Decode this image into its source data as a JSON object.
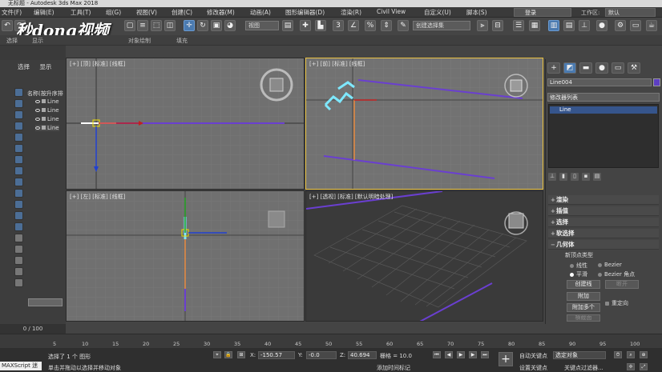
{
  "window": {
    "title": "无标题 - Autodesk 3ds Max 2018"
  },
  "menu": [
    "文件(F)",
    "编辑(E)",
    "工具(T)",
    "组(G)",
    "视图(V)",
    "创建(C)",
    "修改器(M)",
    "动画(A)",
    "图形编辑器(D)",
    "渲染(R)",
    "Civil View",
    "自定义(U)",
    "脚本(S)"
  ],
  "signin": "登录",
  "workspace": {
    "label": "工作区:",
    "value": "默认"
  },
  "toolbar": {
    "view_dropdown": "视图",
    "selection_set": "创建选择集"
  },
  "ribbon": [
    "选择",
    "显示",
    "对象绘制",
    "填充"
  ],
  "watermark": "秒dong视频",
  "scene_explorer": {
    "tabs": [
      "选择",
      "显示"
    ],
    "header": "名称(按升序排",
    "items": [
      "Line",
      "Line",
      "Line",
      "Line"
    ]
  },
  "frames": "0 / 100",
  "viewports": {
    "top": "[+] [顶] [标准] [线框]",
    "front": "[+] [前] [标准] [线框]",
    "left": "[+] [左] [标准] [线框]",
    "perspective": "[+] [透视] [标准] [默认明暗处理]"
  },
  "command_panel": {
    "object_name": "Line004",
    "object_color": "#5d3fc2",
    "modifier_list": "修改器列表",
    "stack_item": "Line",
    "rollouts": [
      "渲染",
      "插值",
      "选择",
      "软选择",
      "几何体"
    ],
    "new_vertex_type": "新顶点类型",
    "vertex_types": [
      {
        "label": "线性",
        "checked": false
      },
      {
        "label": "Bezier",
        "checked": false
      },
      {
        "label": "平滑",
        "checked": true
      },
      {
        "label": "Bezier 角点",
        "checked": false
      }
    ],
    "buttons": {
      "create_line": "创建线",
      "break": "断开",
      "attach": "附加",
      "attach_multiple": "附加多个",
      "reorient": "重定向",
      "cross_section": "横截面"
    }
  },
  "timeline": {
    "ticks": [
      "5",
      "10",
      "15",
      "20",
      "25",
      "30",
      "35",
      "40",
      "45",
      "50",
      "55",
      "60",
      "65",
      "70",
      "75",
      "80",
      "85",
      "90",
      "95",
      "100"
    ]
  },
  "status": {
    "maxscript": "MAXScript 迷",
    "selected": "选择了 1 个 图形",
    "prompt": "单击并拖动以选择并移动对象",
    "x_label": "X:",
    "x": "-150.57",
    "y_label": "Y:",
    "y": "-0.0",
    "z_label": "Z:",
    "z": "40.694",
    "grid": "栅格 = 10.0",
    "add_time_tag": "添加时间标记",
    "auto_key": "自动关键点",
    "set_key": "设置关键点",
    "selected_objects": "选定对象",
    "key_filters": "关键点过滤器..."
  }
}
